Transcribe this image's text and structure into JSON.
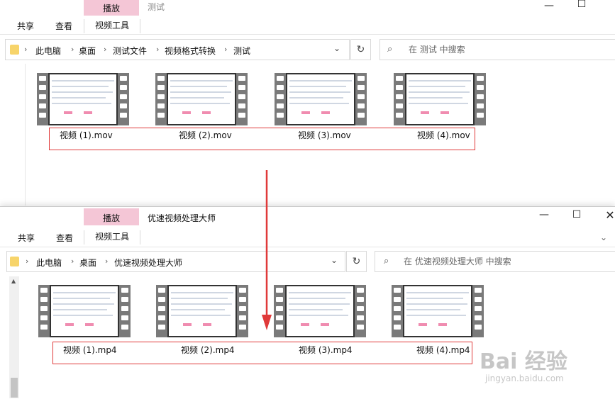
{
  "window1": {
    "ribbon": {
      "tabs": [
        "共享",
        "查看"
      ],
      "context_group_label": "播放",
      "context_tab_label": "视频工具",
      "title": "测试"
    },
    "address": {
      "crumbs": [
        "此电脑",
        "桌面",
        "测试文件",
        "视频格式转换",
        "测试"
      ],
      "dropdown_icon": "chevron-down-icon",
      "refresh_icon": "refresh-icon"
    },
    "search": {
      "placeholder": "在 测试 中搜索"
    },
    "files": [
      {
        "name": "视频 (1).mov"
      },
      {
        "name": "视频 (2).mov"
      },
      {
        "name": "视频 (3).mov"
      },
      {
        "name": "视频 (4).mov"
      }
    ]
  },
  "window2": {
    "ribbon": {
      "tabs": [
        "共享",
        "查看"
      ],
      "context_group_label": "播放",
      "context_tab_label": "视频工具",
      "title": "优速视频处理大师"
    },
    "address": {
      "crumbs": [
        "此电脑",
        "桌面",
        "优速视频处理大师"
      ],
      "dropdown_icon": "chevron-down-icon",
      "refresh_icon": "refresh-icon"
    },
    "search": {
      "placeholder": "在 优速视频处理大师 中搜索"
    },
    "files": [
      {
        "name": "视频 (1).mp4"
      },
      {
        "name": "视频 (2).mp4"
      },
      {
        "name": "视频 (3).mp4"
      },
      {
        "name": "视频 (4).mp4"
      }
    ],
    "controls": [
      "minimize",
      "maximize",
      "close"
    ]
  },
  "colors": {
    "context_tab": "#f4c6d6",
    "highlight_box": "#e03a3a",
    "arrow": "#e03a3a"
  },
  "watermark": {
    "brand": "Bai 经验",
    "url": "jingyan.baidu.com"
  }
}
